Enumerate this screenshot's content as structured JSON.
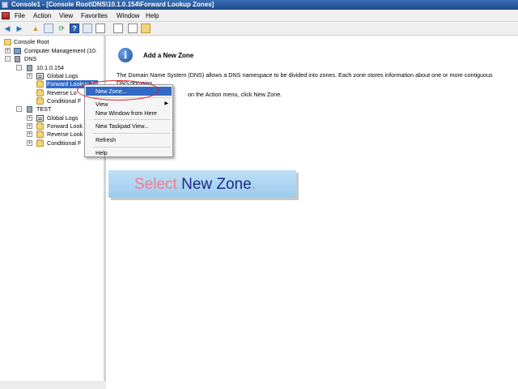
{
  "window": {
    "title": "Console1 - [Console Root\\DNS\\10.1.0.154\\Forward Lookup Zones]"
  },
  "menu": [
    "File",
    "Action",
    "View",
    "Favorites",
    "Window",
    "Help"
  ],
  "toolbar": {
    "buttons": [
      "back-icon",
      "forward-icon",
      "up-icon",
      "show-hide-tree-icon",
      "refresh-icon",
      "help-icon",
      "properties-icon",
      "list-icon",
      "export-icon",
      "new-zone-icon"
    ]
  },
  "tree": {
    "console_root": "Console Root",
    "computer_management": "Computer Management (10.",
    "dns": "DNS",
    "server1": "10.1.0.154",
    "server1_global_logs": "Global Logs",
    "server1_forward": "Forward Lookup Zo",
    "server1_reverse": "Reverse Lo",
    "server1_conditional": "Conditional F",
    "server2": "TEST",
    "server2_global_logs": "Global Logs",
    "server2_forward": "Forward Look",
    "server2_reverse": "Reverse Look",
    "server2_conditional": "Conditional F"
  },
  "content": {
    "heading": "Add a New Zone",
    "paragraph": "The Domain Name System (DNS) allows a DNS namespace to be divided into zones. Each zone stores information about one or more contiguous DNS domains.",
    "paragraph2": "on the Action menu, click New Zone."
  },
  "context_menu": {
    "new_zone": "New Zone...",
    "view": "View",
    "new_window": "New Window from Here",
    "new_taskpad": "New Taskpad View...",
    "refresh": "Refresh",
    "help": "Help"
  },
  "instruction": {
    "word1": "Select",
    "word2": "New Zone",
    "suffix": "."
  },
  "colors": {
    "selection": "#316ac5",
    "highlight_ring": "#d0202a",
    "callout_bg": "#bfe0f6",
    "callout_select": "#f47c8c",
    "callout_target": "#1b2a88"
  }
}
